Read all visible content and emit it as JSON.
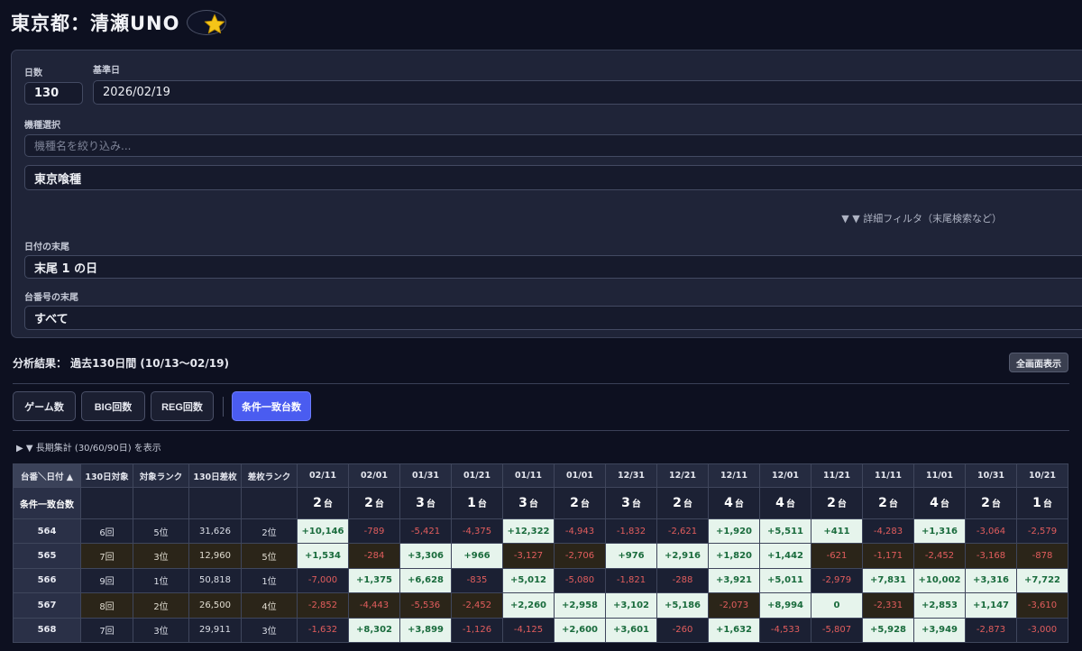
{
  "header": {
    "title": "東京都：清瀬UNO"
  },
  "filters": {
    "days_label": "日数",
    "days_value": "130",
    "base_date_label": "基準日",
    "base_date_value": "2026/02/19",
    "model_label": "機種選択",
    "model_search_placeholder": "機種名を絞り込み...",
    "model_selected": "東京喰種",
    "advanced_filter": "▼ ▼ 詳細フィルタ（末尾検索など）",
    "date_suffix_label": "日付の末尾",
    "date_suffix_value": "末尾 1 の日",
    "machine_suffix_label": "台番号の末尾",
    "machine_suffix_value": "すべて"
  },
  "analysis": {
    "summary": "分析結果： 過去130日間 (10/13〜02/19)",
    "fullscreen_label": "全画面表示"
  },
  "tabs": [
    {
      "label": "ゲーム数",
      "active": false
    },
    {
      "label": "BIG回数",
      "active": false
    },
    {
      "label": "REG回数",
      "active": false
    },
    {
      "label": "条件一致台数",
      "active": true
    }
  ],
  "longterm_toggle": "▶ ▼ 長期集計 (30/60/90日) を表示",
  "table": {
    "corner_label": "台番＼日付 ▲",
    "match_row_label": "条件一致台数",
    "meta_columns": [
      "130日対象",
      "対象ランク",
      "130日差枚",
      "差枚ランク"
    ],
    "dates": [
      "02/11",
      "02/01",
      "01/31",
      "01/21",
      "01/11",
      "01/01",
      "12/31",
      "12/21",
      "12/11",
      "12/01",
      "11/21",
      "11/11",
      "11/01",
      "10/31",
      "10/21"
    ],
    "match_counts": [
      "2",
      "2",
      "3",
      "1",
      "3",
      "2",
      "3",
      "2",
      "4",
      "4",
      "2",
      "2",
      "4",
      "2",
      "1"
    ],
    "unit": "台",
    "rows": [
      {
        "id": "564",
        "count": "6回",
        "rank": "5位",
        "diff": "31,626",
        "diff_rank": "2位",
        "values": [
          "+10,146",
          "-789",
          "-5,421",
          "-4,375",
          "+12,322",
          "-4,943",
          "-1,832",
          "-2,621",
          "+1,920",
          "+5,511",
          "+411",
          "-4,283",
          "+1,316",
          "-3,064",
          "-2,579"
        ]
      },
      {
        "id": "565",
        "count": "7回",
        "rank": "3位",
        "diff": "12,960",
        "diff_rank": "5位",
        "values": [
          "+1,534",
          "-284",
          "+3,306",
          "+966",
          "-3,127",
          "-2,706",
          "+976",
          "+2,916",
          "+1,820",
          "+1,442",
          "-621",
          "-1,171",
          "-2,452",
          "-3,168",
          "-878"
        ]
      },
      {
        "id": "566",
        "count": "9回",
        "rank": "1位",
        "diff": "50,818",
        "diff_rank": "1位",
        "values": [
          "-7,000",
          "+1,375",
          "+6,628",
          "-835",
          "+5,012",
          "-5,080",
          "-1,821",
          "-288",
          "+3,921",
          "+5,011",
          "-2,979",
          "+7,831",
          "+10,002",
          "+3,316",
          "+7,722"
        ]
      },
      {
        "id": "567",
        "count": "8回",
        "rank": "2位",
        "diff": "26,500",
        "diff_rank": "4位",
        "values": [
          "-2,852",
          "-4,443",
          "-5,536",
          "-2,452",
          "+2,260",
          "+2,958",
          "+3,102",
          "+5,186",
          "-2,073",
          "+8,994",
          "0",
          "-2,331",
          "+2,853",
          "+1,147",
          "-3,610"
        ]
      },
      {
        "id": "568",
        "count": "7回",
        "rank": "3位",
        "diff": "29,911",
        "diff_rank": "3位",
        "values": [
          "-1,632",
          "+8,302",
          "+3,899",
          "-1,126",
          "-4,125",
          "+2,600",
          "+3,601",
          "-260",
          "+1,632",
          "-4,533",
          "-5,807",
          "+5,928",
          "+3,949",
          "-2,873",
          "-3,000"
        ]
      }
    ]
  },
  "colors": {
    "accent": "#4a5cf0",
    "positive_bg": "#e6f4ec",
    "negative_text": "#e25d5d",
    "star": "#f5c518"
  }
}
